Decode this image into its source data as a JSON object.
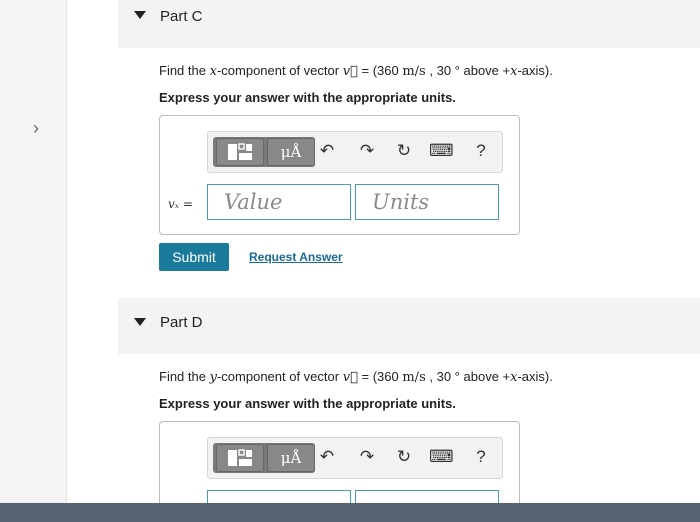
{
  "sidebar": {
    "expand_icon": "chevron-right-icon",
    "expand_glyph": "›"
  },
  "parts": [
    {
      "title": "Part C",
      "question": {
        "prefix": "Find the",
        "component_var": "x",
        "mid": "-component of vector",
        "vector_symbol": "v⃗",
        "equals": "= (360",
        "unit_text": "m/s",
        "angle": ", 30 °",
        "above": "above +",
        "axis_var": "x",
        "suffix": "-axis)."
      },
      "instruction": "Express your answer with the appropriate units.",
      "variable_label": "vₓ =",
      "value_placeholder": "Value",
      "units_placeholder": "Units",
      "submit_label": "Submit",
      "request_answer_label": "Request Answer"
    },
    {
      "title": "Part D",
      "question": {
        "prefix": "Find the",
        "component_var": "y",
        "mid": "-component of vector",
        "vector_symbol": "v⃗",
        "equals": "= (360",
        "unit_text": "m/s",
        "angle": ", 30 °",
        "above": "above +",
        "axis_var": "x",
        "suffix": "-axis)."
      },
      "instruction": "Express your answer with the appropriate units."
    }
  ],
  "toolbar": {
    "templates_icon": "templates-icon",
    "units_glyph": "μÅ",
    "undo_glyph": "↶",
    "redo_glyph": "↷",
    "reset_glyph": "↻",
    "keyboard_glyph": "⌨",
    "help_glyph": "?"
  },
  "colors": {
    "submit": "#1a7a9c",
    "link": "#1a6a96",
    "field_border": "#4a9cb5",
    "bottom_bar": "#566371"
  }
}
